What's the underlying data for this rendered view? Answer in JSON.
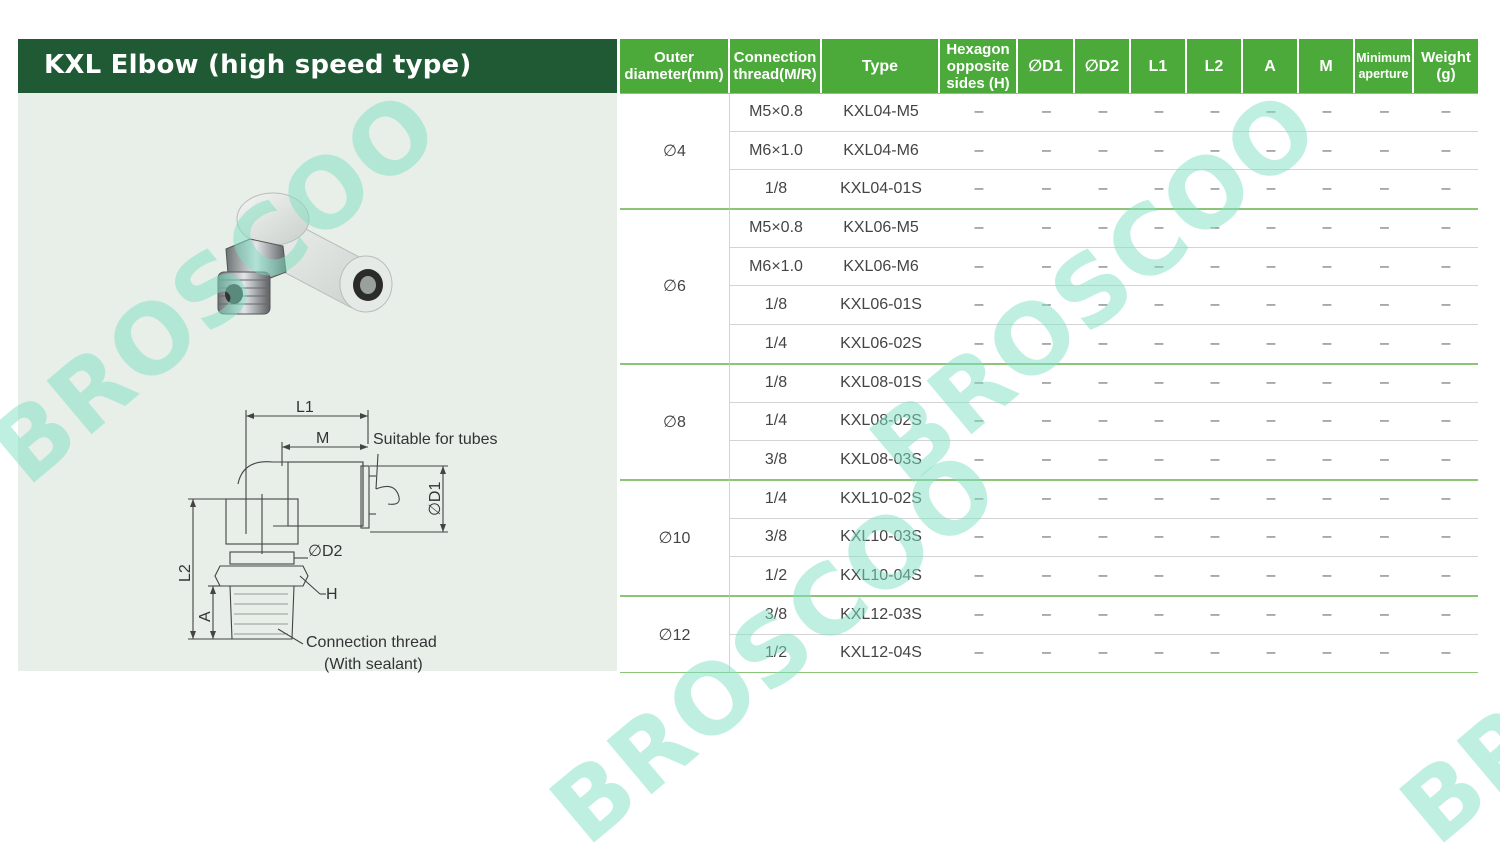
{
  "title": "KXL Elbow (high speed type)",
  "watermark": "BROSCOO",
  "diagram": {
    "l1": "L1",
    "m": "M",
    "suitable_for_tubes": "Suitable for tubes",
    "d1": "∅D1",
    "d2": "∅D2",
    "l2": "L2",
    "h": "H",
    "a": "A",
    "connection_thread": "Connection thread",
    "with_sealant": "(With sealant)"
  },
  "table": {
    "headers": [
      [
        "Outer",
        "diameter(mm)"
      ],
      [
        "Connection",
        "thread(M/R)"
      ],
      [
        "Type"
      ],
      [
        "Hexagon",
        "opposite",
        "sides (H)"
      ],
      [
        "∅D1"
      ],
      [
        "∅D2"
      ],
      [
        "L1"
      ],
      [
        "L2"
      ],
      [
        "A"
      ],
      [
        "M"
      ],
      [
        "Minimum",
        "aperture"
      ],
      [
        "Weight",
        "(g)"
      ]
    ],
    "groups": [
      {
        "od": "∅4",
        "rows": [
          {
            "thread": "M5×0.8",
            "type": "KXL04-M5",
            "values": [
              "–",
              "–",
              "–",
              "–",
              "–",
              "–",
              "–",
              "–",
              "–"
            ]
          },
          {
            "thread": "M6×1.0",
            "type": "KXL04-M6",
            "values": [
              "–",
              "–",
              "–",
              "–",
              "–",
              "–",
              "–",
              "–",
              "–"
            ]
          },
          {
            "thread": "1/8",
            "type": "KXL04-01S",
            "values": [
              "–",
              "–",
              "–",
              "–",
              "–",
              "–",
              "–",
              "–",
              "–"
            ]
          }
        ]
      },
      {
        "od": "∅6",
        "rows": [
          {
            "thread": "M5×0.8",
            "type": "KXL06-M5",
            "values": [
              "–",
              "–",
              "–",
              "–",
              "–",
              "–",
              "–",
              "–",
              "–"
            ]
          },
          {
            "thread": "M6×1.0",
            "type": "KXL06-M6",
            "values": [
              "–",
              "–",
              "–",
              "–",
              "–",
              "–",
              "–",
              "–",
              "–"
            ]
          },
          {
            "thread": "1/8",
            "type": "KXL06-01S",
            "values": [
              "–",
              "–",
              "–",
              "–",
              "–",
              "–",
              "–",
              "–",
              "–"
            ]
          },
          {
            "thread": "1/4",
            "type": "KXL06-02S",
            "values": [
              "–",
              "–",
              "–",
              "–",
              "–",
              "–",
              "–",
              "–",
              "–"
            ]
          }
        ]
      },
      {
        "od": "∅8",
        "rows": [
          {
            "thread": "1/8",
            "type": "KXL08-01S",
            "values": [
              "–",
              "–",
              "–",
              "–",
              "–",
              "–",
              "–",
              "–",
              "–"
            ]
          },
          {
            "thread": "1/4",
            "type": "KXL08-02S",
            "values": [
              "–",
              "–",
              "–",
              "–",
              "–",
              "–",
              "–",
              "–",
              "–"
            ]
          },
          {
            "thread": "3/8",
            "type": "KXL08-03S",
            "values": [
              "–",
              "–",
              "–",
              "–",
              "–",
              "–",
              "–",
              "–",
              "–"
            ]
          }
        ]
      },
      {
        "od": "∅10",
        "rows": [
          {
            "thread": "1/4",
            "type": "KXL10-02S",
            "values": [
              "–",
              "–",
              "–",
              "–",
              "–",
              "–",
              "–",
              "–",
              "–"
            ]
          },
          {
            "thread": "3/8",
            "type": "KXL10-03S",
            "values": [
              "–",
              "–",
              "–",
              "–",
              "–",
              "–",
              "–",
              "–",
              "–"
            ]
          },
          {
            "thread": "1/2",
            "type": "KXL10-04S",
            "values": [
              "–",
              "–",
              "–",
              "–",
              "–",
              "–",
              "–",
              "–",
              "–"
            ]
          }
        ]
      },
      {
        "od": "∅12",
        "rows": [
          {
            "thread": "3/8",
            "type": "KXL12-03S",
            "values": [
              "–",
              "–",
              "–",
              "–",
              "–",
              "–",
              "–",
              "–",
              "–"
            ]
          },
          {
            "thread": "1/2",
            "type": "KXL12-04S",
            "values": [
              "–",
              "–",
              "–",
              "–",
              "–",
              "–",
              "–",
              "–",
              "–"
            ]
          }
        ]
      }
    ]
  },
  "colors": {
    "title_bar": "#1f5a34",
    "header_green": "#4caa3a",
    "panel_bg": "#e8efe9",
    "watermark": "#7fe0c2"
  }
}
